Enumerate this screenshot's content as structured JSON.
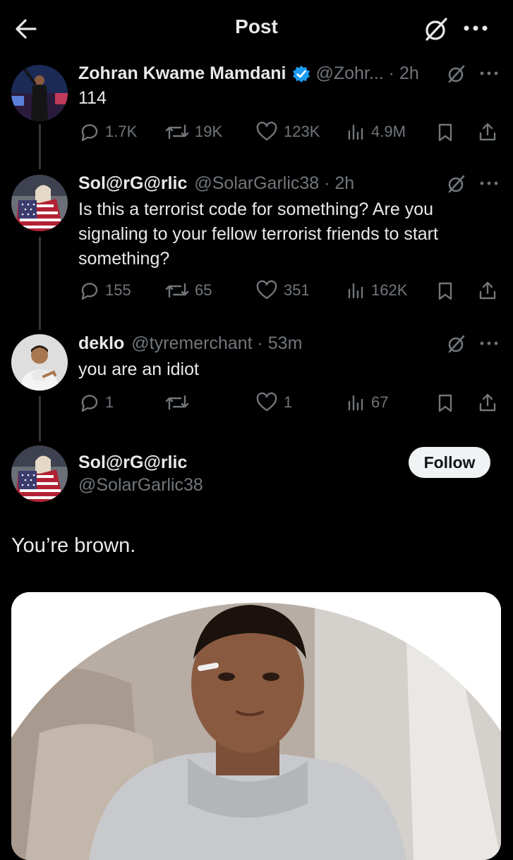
{
  "header": {
    "title": "Post"
  },
  "colors": {
    "verified": "#1d9bf0",
    "muted": "#71767b",
    "text": "#e7e9ea",
    "bg": "#000000"
  },
  "tweets": [
    {
      "display_name": "Zohran Kwame Mamdani",
      "verified": true,
      "handle_time": "@Zohr... · 2h",
      "text": "114",
      "stats": {
        "replies": "1.7K",
        "reposts": "19K",
        "likes": "123K",
        "views": "4.9M"
      }
    },
    {
      "display_name": "Sol@rG@rlic",
      "handle_time": "@SolarGarlic38 · 2h",
      "text": "Is this a terrorist code for something? Are you signaling to your fellow terrorist friends to start something?",
      "stats": {
        "replies": "155",
        "reposts": "65",
        "likes": "351",
        "views": "162K"
      }
    },
    {
      "display_name": "deklo",
      "handle_time": "@tyremerchant · 53m",
      "text": "you are an idiot",
      "stats": {
        "replies": "1",
        "reposts": "",
        "likes": "1",
        "views": "67"
      }
    }
  ],
  "main_post": {
    "display_name": "Sol@rG@rlic",
    "handle": "@SolarGarlic38",
    "follow_label": "Follow",
    "text": "You’re brown."
  }
}
